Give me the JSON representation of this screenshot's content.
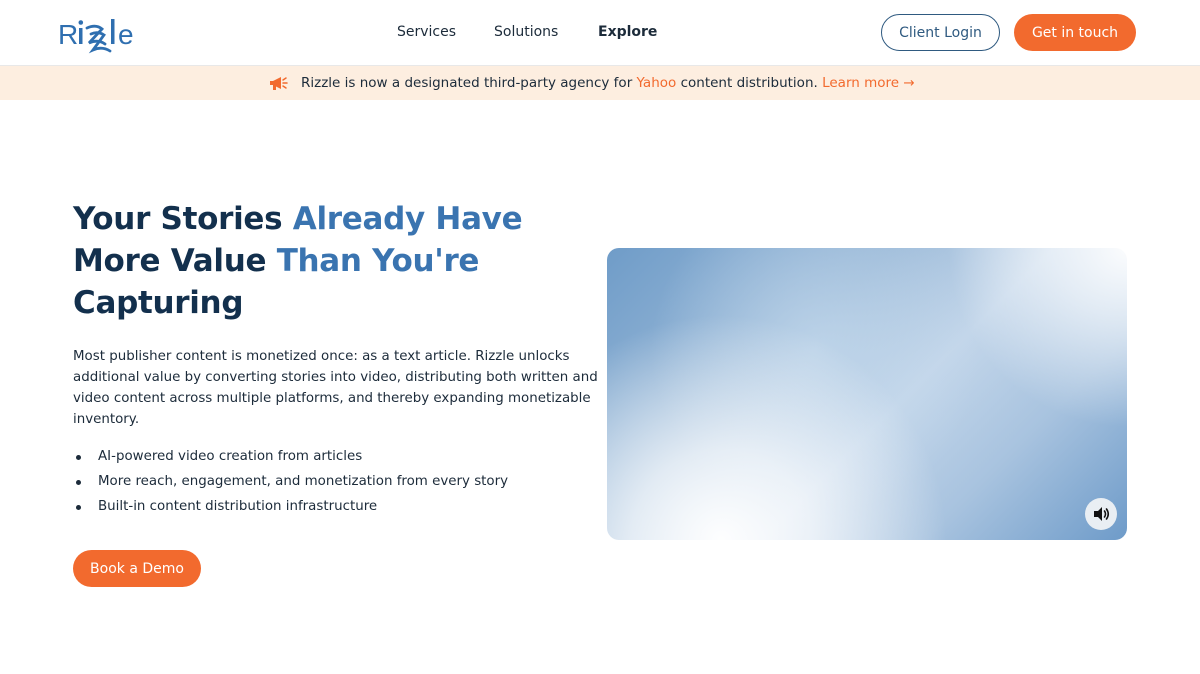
{
  "header": {
    "logo_text": "Rizzle",
    "nav": [
      {
        "label": "Services"
      },
      {
        "label": "Solutions"
      },
      {
        "label": "Explore"
      }
    ],
    "client_login_label": "Client Login",
    "get_in_touch_label": "Get in touch"
  },
  "announcement": {
    "icon": "megaphone-icon",
    "text_before": "Rizzle is now a designated third-party agency for ",
    "highlight": "Yahoo",
    "text_after": " content distribution. ",
    "link_label": "Learn more →"
  },
  "hero": {
    "title_part1": "Your Stories ",
    "title_part2": "Already Have",
    "title_part3": "More Value ",
    "title_part4": "Than You're",
    "title_part5": "Capturing",
    "description": "Most publisher content is monetized once: as a text article. Rizzle unlocks additional value by converting stories into video, distributing both written and video content across multiple platforms, and thereby expanding monetizable inventory.",
    "bullets": [
      "AI-powered video creation from articles",
      "More reach, engagement, and monetization from every story",
      "Built-in content distribution infrastructure"
    ],
    "cta_label": "Book a Demo"
  },
  "video": {
    "mute_icon": "speaker-icon"
  },
  "colors": {
    "accent": "#f26a2e",
    "navy": "#13304d",
    "blue": "#3a74b0",
    "banner_bg": "#fdeee0"
  }
}
